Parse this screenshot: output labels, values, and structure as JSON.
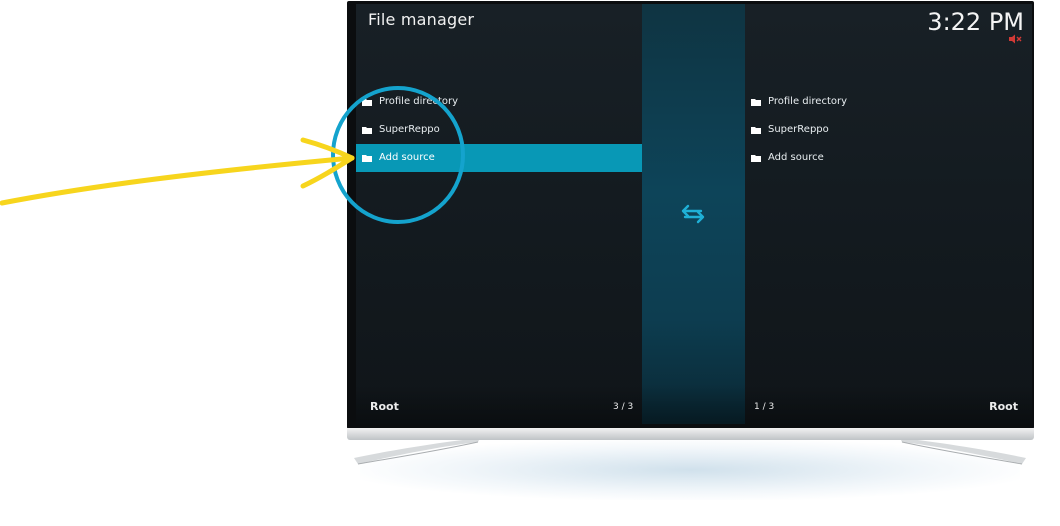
{
  "header": {
    "title": "File manager",
    "clock": "3:22 PM"
  },
  "left_pane": {
    "items": [
      {
        "label": "Profile directory",
        "icon": "folder-icon",
        "selected": false
      },
      {
        "label": "SuperReppo",
        "icon": "folder-icon",
        "selected": false
      },
      {
        "label": "Add source",
        "icon": "folder-icon",
        "selected": true
      }
    ],
    "footer_label": "Root",
    "position": "3 / 3"
  },
  "right_pane": {
    "items": [
      {
        "label": "Profile directory",
        "icon": "folder-icon",
        "selected": false
      },
      {
        "label": "SuperReppo",
        "icon": "folder-icon",
        "selected": false
      },
      {
        "label": "Add source",
        "icon": "folder-icon",
        "selected": false
      }
    ],
    "footer_label": "Root",
    "position": "1 / 3"
  },
  "icons": {
    "swap": "swap-arrows-icon",
    "mute": "mute-icon"
  },
  "colors": {
    "selection": "#0898b6",
    "annotation_arrow": "#f7d51d",
    "annotation_circle": "#14a3cd",
    "mute": "#d23a36"
  }
}
